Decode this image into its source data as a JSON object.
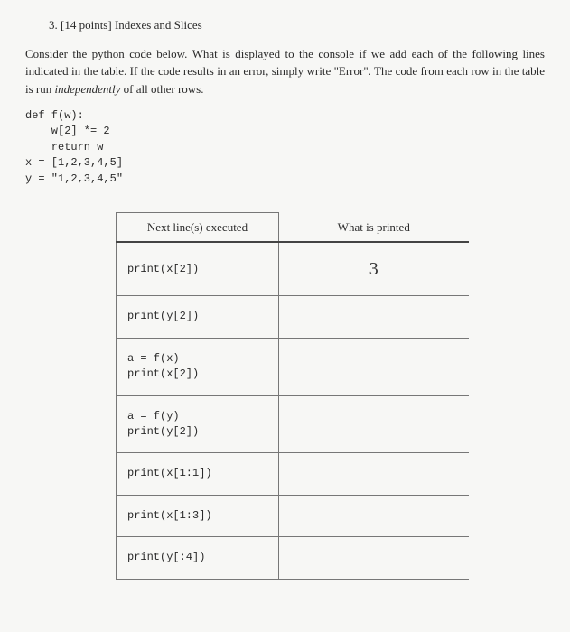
{
  "heading": "3. [14 points] Indexes and Slices",
  "intro_part1": "Consider the python code below. What is displayed to the console if we add each of the following lines indicated in the table. If the code results in an error, simply write \"Error\". The code from each row in the table is run ",
  "intro_em": "independently",
  "intro_part2": " of all other rows.",
  "code_line1": "def f(w):",
  "code_line2": "    w[2] *= 2",
  "code_line3": "    return w",
  "code_line4": "x = [1,2,3,4,5]",
  "code_line5": "y = \"1,2,3,4,5\"",
  "table": {
    "header_left": "Next line(s) executed",
    "header_right": "What is printed",
    "rows": [
      {
        "code": "print(x[2])",
        "answer": "3"
      },
      {
        "code": "print(y[2])",
        "answer": ""
      },
      {
        "code": "a = f(x)\nprint(x[2])",
        "answer": ""
      },
      {
        "code": "a = f(y)\nprint(y[2])",
        "answer": ""
      },
      {
        "code": "print(x[1:1])",
        "answer": ""
      },
      {
        "code": "print(x[1:3])",
        "answer": ""
      },
      {
        "code": "print(y[:4])",
        "answer": ""
      }
    ]
  }
}
